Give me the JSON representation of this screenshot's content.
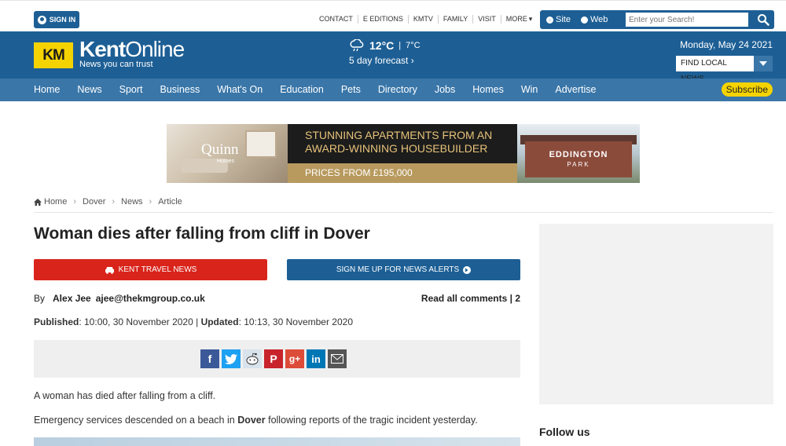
{
  "topbar": {
    "signin_label": "SIGN IN",
    "links": [
      "CONTACT",
      "E EDITIONS",
      "KMTV",
      "FAMILY",
      "VISIT",
      "MORE"
    ],
    "search": {
      "option_site": "Site",
      "option_web": "Web",
      "placeholder": "Enter your Search!"
    }
  },
  "header": {
    "logo_text": "KM",
    "brand_bold": "Kent",
    "brand_light": "Online",
    "tagline": "News you can trust",
    "weather": {
      "high": "12°C",
      "low": "7°C",
      "forecast": "5 day forecast ›"
    },
    "date": "Monday, May 24 2021",
    "find_local": "FIND LOCAL NEWS"
  },
  "nav": {
    "items": [
      "Home",
      "News",
      "Sport",
      "Business",
      "What's On",
      "Education",
      "Pets",
      "Directory",
      "Jobs",
      "Homes",
      "Win",
      "Advertise"
    ],
    "subscribe": "Subscribe"
  },
  "ad": {
    "brand": "Quinn",
    "brand_sub": "Homes",
    "headline_1": "STUNNING APARTMENTS FROM AN",
    "headline_2": "AWARD-WINNING HOUSEBUILDER",
    "price": "PRICES FROM £195,000",
    "development": "EDDINGTON",
    "development_sub": "PARK"
  },
  "breadcrumb": [
    "Home",
    "Dover",
    "News",
    "Article"
  ],
  "article": {
    "title": "Woman dies after falling from cliff in Dover",
    "travel_button": "KENT TRAVEL NEWS",
    "alerts_button": "SIGN ME UP FOR NEWS ALERTS",
    "by": "By",
    "author": "Alex Jee",
    "email": "ajee@thekmgroup.co.uk",
    "comments": "Read all comments | 2",
    "published_label": "Published",
    "published_value": ": 10:00, 30 November 2020 | ",
    "updated_label": "Updated",
    "updated_value": ": 10:13, 30 November 2020",
    "para1": "A woman has died after falling from a cliff.",
    "para2_before": "Emergency services descended on a beach in ",
    "para2_bold": "Dover",
    "para2_after": " following reports of the tragic incident yesterday."
  },
  "sidebar": {
    "follow_title": "Follow us"
  },
  "colors": {
    "brand_blue": "#1d5f95",
    "nav_blue": "#3a76a8",
    "yellow": "#f5d300",
    "red": "#d9241b"
  }
}
